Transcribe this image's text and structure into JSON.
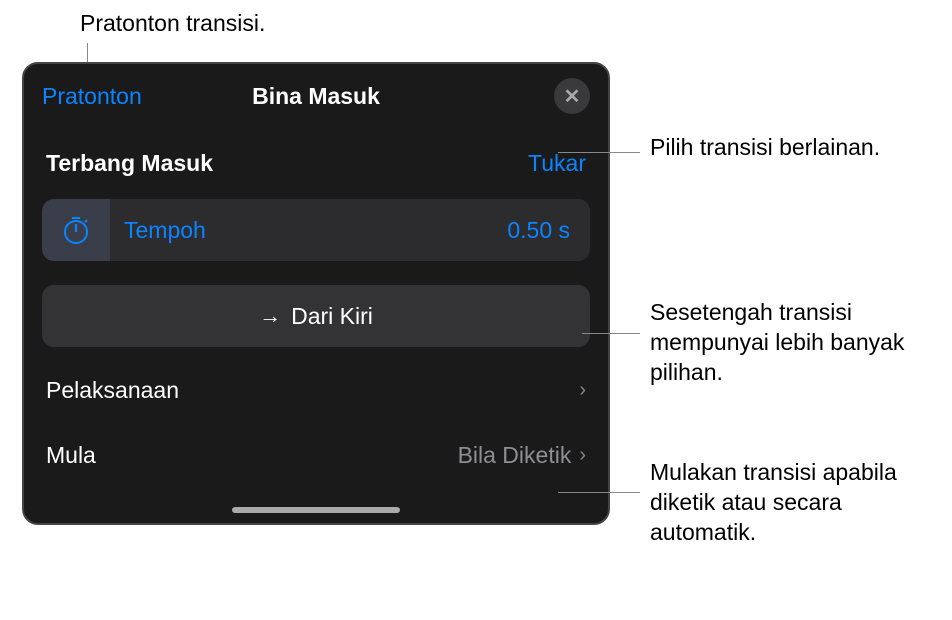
{
  "callouts": {
    "top": "Pratonton transisi.",
    "change": "Pilih transisi berlainan.",
    "direction": "Sesetengah transisi mempunyai lebih banyak pilihan.",
    "start": "Mulakan transisi apabila diketik atau secara automatik."
  },
  "panel": {
    "preview": "Pratonton",
    "title": "Bina Masuk",
    "effect_name": "Terbang Masuk",
    "change": "Tukar",
    "duration_label": "Tempoh",
    "duration_value": "0.50 s",
    "direction": "Dari Kiri",
    "execution": "Pelaksanaan",
    "start_label": "Mula",
    "start_value": "Bila Diketik"
  }
}
